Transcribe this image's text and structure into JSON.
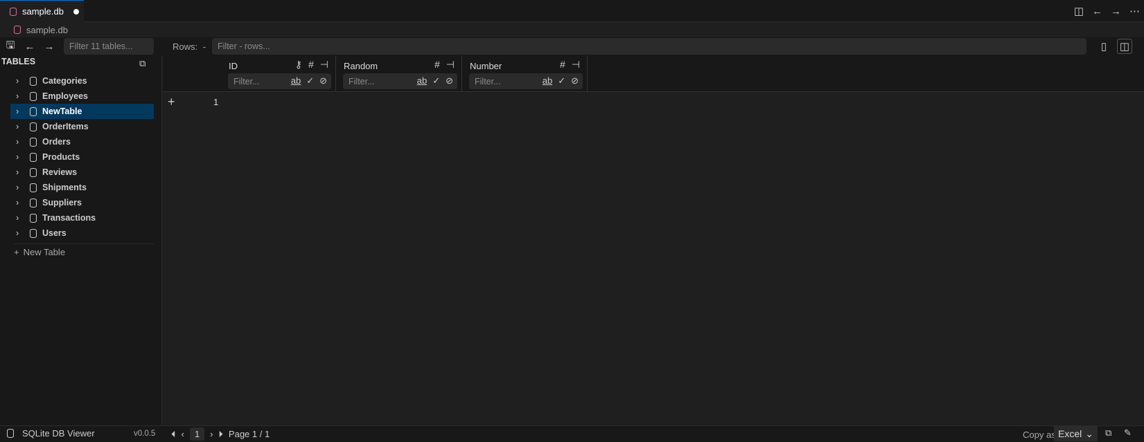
{
  "tab": {
    "title": "sample.db"
  },
  "breadcrumb": "sample.db",
  "toolbar": {
    "filter_tables_placeholder": "Filter 11 tables...",
    "rows_label": "Rows:",
    "rows_value": "-",
    "filter_rows_placeholder": "Filter - rows..."
  },
  "sidebar": {
    "header": "TABLES",
    "items": [
      "Categories",
      "Employees",
      "NewTable",
      "OrderItems",
      "Orders",
      "Products",
      "Reviews",
      "Shipments",
      "Suppliers",
      "Transactions",
      "Users"
    ],
    "selected": "NewTable",
    "new_table": "New Table"
  },
  "columns": [
    {
      "name": "ID",
      "filter": "Filter..."
    },
    {
      "name": "Random",
      "filter": "Filter..."
    },
    {
      "name": "Number",
      "filter": "Filter..."
    }
  ],
  "rows": [
    {
      "num": "1"
    }
  ],
  "status": {
    "app": "SQLite DB Viewer",
    "version": "v0.0.5",
    "page_input": "1",
    "page_text": "Page 1 / 1",
    "copy_as": "Copy as",
    "format": "Excel"
  }
}
